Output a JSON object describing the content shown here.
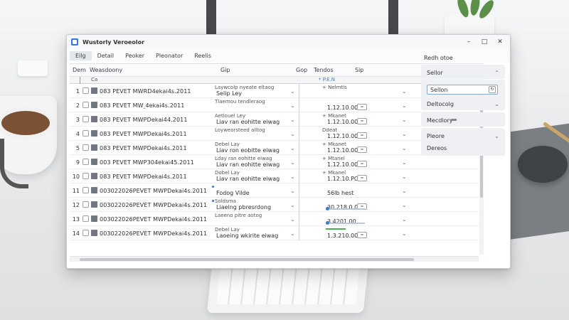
{
  "app": {
    "title": "Wustorly Veroeolor",
    "controls": {
      "minimize": "–",
      "maximize": "□",
      "close": "✕"
    }
  },
  "menu": [
    {
      "label": "Eilg",
      "active": true
    },
    {
      "label": "Detail",
      "active": false
    },
    {
      "label": "Peoker",
      "active": false
    },
    {
      "label": "Pleonator",
      "active": false
    },
    {
      "label": "Reelis",
      "active": false
    }
  ],
  "grid": {
    "headers": {
      "col_a": "Dem",
      "col_b": "Weasdoony",
      "col_c": "Gip",
      "col_d": "Gop",
      "col_e": "Tendos",
      "col_f": "Sip"
    },
    "subheader": "Ca",
    "scroll_marker": "* P.E.N",
    "rows": [
      {
        "num": "1",
        "file": "083 PEVET MWRD4ekai4s.2011",
        "d1": "Laywcolp nyeate eltaog",
        "d2": "Selip Ley",
        "t1": "+ Nelmtls",
        "t2": "",
        "mini": "",
        "dot": false,
        "slider": false,
        "green": false
      },
      {
        "num": "2",
        "file": "083 PEVET MW‸4ekai4s.2011",
        "d1": "Tlaemou tendleraog",
        "d2": "",
        "t1": "",
        "t2": "1.12.10.00",
        "mini": "=",
        "dot": false,
        "slider": false,
        "green": false
      },
      {
        "num": "3",
        "file": "083 PEVET MWPDekai44.2011",
        "d1": "Aetlouel Ley",
        "d2": "Liav ran eohitte eiwag",
        "t1": "+ Mkanet",
        "t2": "1.12.10.00",
        "mini": "=",
        "dot": false,
        "slider": false,
        "green": false
      },
      {
        "num": "4",
        "file": "083 PEVET MWPDekai4s.2011",
        "d1": "Loyweorsteed alltog",
        "d2": "",
        "t1": "Ddeat",
        "t2": "1.12.10.00",
        "mini": "=",
        "dot": false,
        "slider": false,
        "green": false
      },
      {
        "num": "5",
        "file": "083 PEVET MWPDekai4s.2011",
        "d1": "Debel Lay",
        "d2": "Liav ron eobitte eiwag",
        "t1": "+ Mkanet",
        "t2": "1.12.10.00",
        "mini": "=",
        "dot": false,
        "slider": false,
        "green": false
      },
      {
        "num": "9",
        "file": "003 PEVET MWP304ekai45.2011",
        "d1": "Lday ran eohitte eiwag",
        "d2": "Liav ran eohitte eiwag",
        "t1": "+ Mtanel",
        "t2": "1.12.10.00",
        "mini": "=",
        "dot": false,
        "slider": false,
        "green": false
      },
      {
        "num": "10",
        "file": "083 PEVET MWPDekai4s.2011",
        "d1": "Dobel Lay",
        "d2": "Liav ran eohitte eiwag",
        "t1": "+ Mkanel",
        "t2": "1.12.10.PO",
        "mini": "=",
        "dot": false,
        "slider": false,
        "green": false
      },
      {
        "num": "11",
        "file": "003022026PEVET MWPDekai4s.2011",
        "d1": "",
        "d2": "Fodog Vilde",
        "t1": "",
        "t2": "56lb hest",
        "mini": "",
        "dot": true,
        "slider": false,
        "green": false
      },
      {
        "num": "12",
        "file": "003022026PEVET MWPDekai4s.2011",
        "d1": "Soldsma",
        "d2": "Liaeing pbresrdong",
        "t1": "",
        "t2": "30.218.0.0",
        "mini": "=",
        "dot": true,
        "slider": true,
        "green": false
      },
      {
        "num": "13",
        "file": "003022026PEVET MWPDekai4s.2011",
        "d1": "Laeeno pitre aotog",
        "d2": "",
        "t1": "",
        "t2": "3.4201.00",
        "mini": "",
        "dot": false,
        "slider": true,
        "green": false
      },
      {
        "num": "14",
        "file": "003022026PEVET MWPDekai4s.2011",
        "d1": "Debel Lay",
        "d2": "Laoeing wkirite eiwag",
        "t1": "",
        "t2": "1.3.210.00",
        "mini": "=",
        "dot": false,
        "slider": false,
        "green": true
      }
    ]
  },
  "right_panel": {
    "title": "Redh otoe",
    "cards": [
      {
        "label": "Sellor",
        "type": "dropdown"
      },
      {
        "label": "Sellon",
        "type": "input"
      },
      {
        "label": "Deltocolg",
        "type": "dropdown"
      },
      {
        "label": "Mecdlory",
        "type": "toggle"
      },
      {
        "label": "Pleore",
        "type": "dropdown"
      },
      {
        "label": "Dereos",
        "type": "text"
      }
    ]
  },
  "colors": {
    "accent": "#3a7bd5",
    "window_bg": "#ffffff",
    "panel_card": "#eef0f3"
  }
}
